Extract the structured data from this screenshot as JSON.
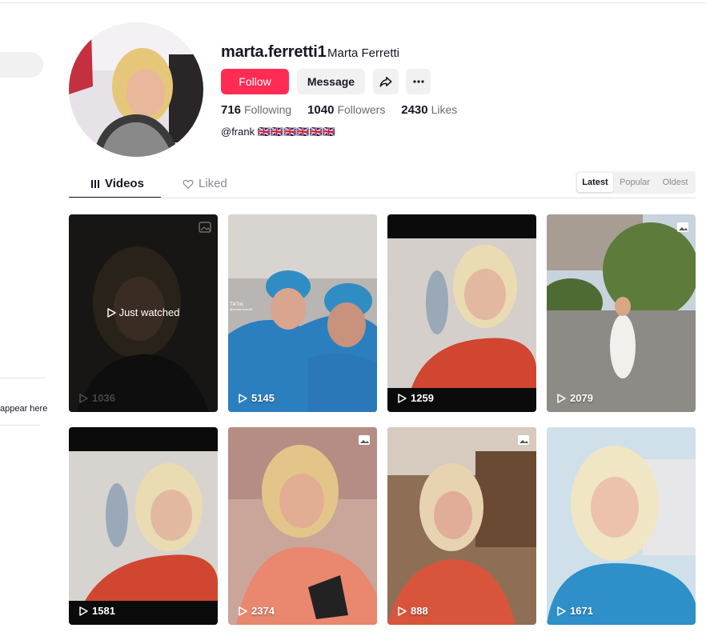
{
  "profile": {
    "username": "marta.ferretti1",
    "nickname": "Marta Ferretti",
    "follow_label": "Follow",
    "message_label": "Message",
    "following_count": "716",
    "following_label": "Following",
    "followers_count": "1040",
    "followers_label": "Followers",
    "likes_count": "2430",
    "likes_label": "Likes",
    "bio": "@frank 🇬🇧🇬🇧🇬🇧🇬🇧🇬🇧🇬🇧"
  },
  "sidebar": {
    "hint_text": "appear here"
  },
  "tabs": {
    "videos": "Videos",
    "liked": "Liked"
  },
  "sort": {
    "latest": "Latest",
    "popular": "Popular",
    "oldest": "Oldest"
  },
  "videos": [
    {
      "views": "1036",
      "overlay": "Just watched",
      "photo": true
    },
    {
      "views": "5145",
      "watermark": "TikTok",
      "watermark_handle": "@marta.ferretti1"
    },
    {
      "views": "1259"
    },
    {
      "views": "2079",
      "photo": true
    },
    {
      "views": "1581"
    },
    {
      "views": "2374",
      "photo": true
    },
    {
      "views": "888",
      "photo": true
    },
    {
      "views": "1671"
    }
  ],
  "colors": {
    "accent": "#fe2c55",
    "text": "#161823",
    "muted": "#8a8b91",
    "button_bg": "#f1f1f2"
  },
  "icons": [
    "share-icon",
    "more-icon",
    "grid-icon",
    "liked-icon",
    "play-icon",
    "photo-icon"
  ]
}
